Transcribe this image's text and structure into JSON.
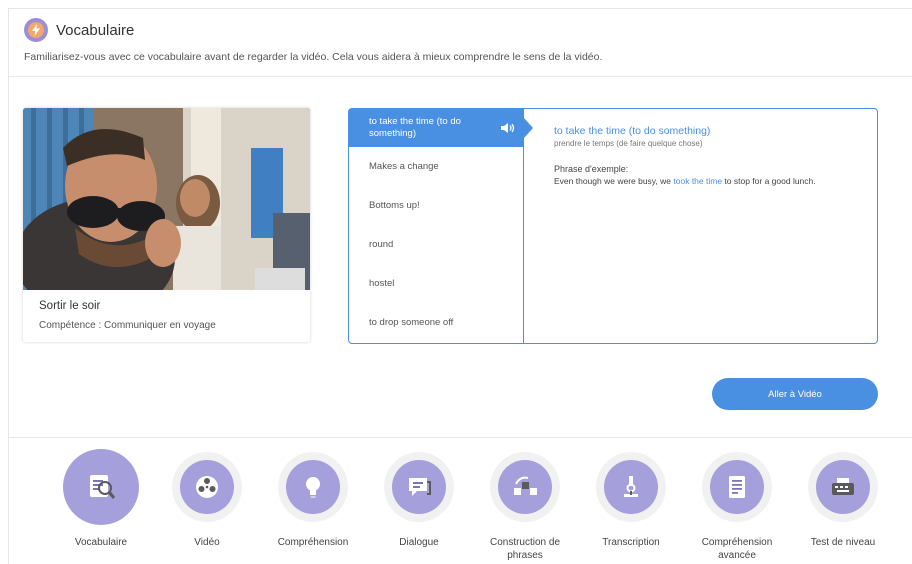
{
  "header": {
    "title": "Vocabulaire",
    "subtitle": "Familiarisez-vous avec ce vocabulaire avant de regarder la vidéo. Cela vous aidera à mieux comprendre le sens de la vidéo.",
    "icon": "lightning-icon"
  },
  "video_card": {
    "title": "Sortir le soir",
    "skill": "Compétence : Communiquer en voyage"
  },
  "vocab": {
    "words": [
      {
        "label": "to take the time (to do something)",
        "active": true
      },
      {
        "label": "Makes a change"
      },
      {
        "label": "Bottoms up!"
      },
      {
        "label": "round"
      },
      {
        "label": "hostel"
      },
      {
        "label": "to drop someone off"
      }
    ],
    "detail": {
      "term": "to take the time (to do something)",
      "translation": "prendre le temps (de faire quelque chose)",
      "example_label": "Phrase d'exemple:",
      "example_before": "Even though we were busy, we ",
      "example_highlight": "took the time",
      "example_after": " to stop for a good lunch."
    }
  },
  "actions": {
    "go_label": "Aller à Vidéo"
  },
  "steps": [
    {
      "label": "Vocabulaire",
      "icon": "vocabulary-magnifier-icon",
      "current": true
    },
    {
      "label": "Vidéo",
      "icon": "film-reel-icon"
    },
    {
      "label": "Compréhension",
      "icon": "lightbulb-icon"
    },
    {
      "label": "Dialogue",
      "icon": "speech-bubble-icon"
    },
    {
      "label": "Construction de phrases",
      "icon": "sentence-builder-icon"
    },
    {
      "label": "Transcription",
      "icon": "microscope-icon"
    },
    {
      "label": "Compréhension avancée",
      "icon": "document-icon"
    },
    {
      "label": "Test de niveau",
      "icon": "typewriter-icon"
    }
  ],
  "colors": {
    "accent": "#4a90e2",
    "step_purple": "#a59fdc"
  }
}
